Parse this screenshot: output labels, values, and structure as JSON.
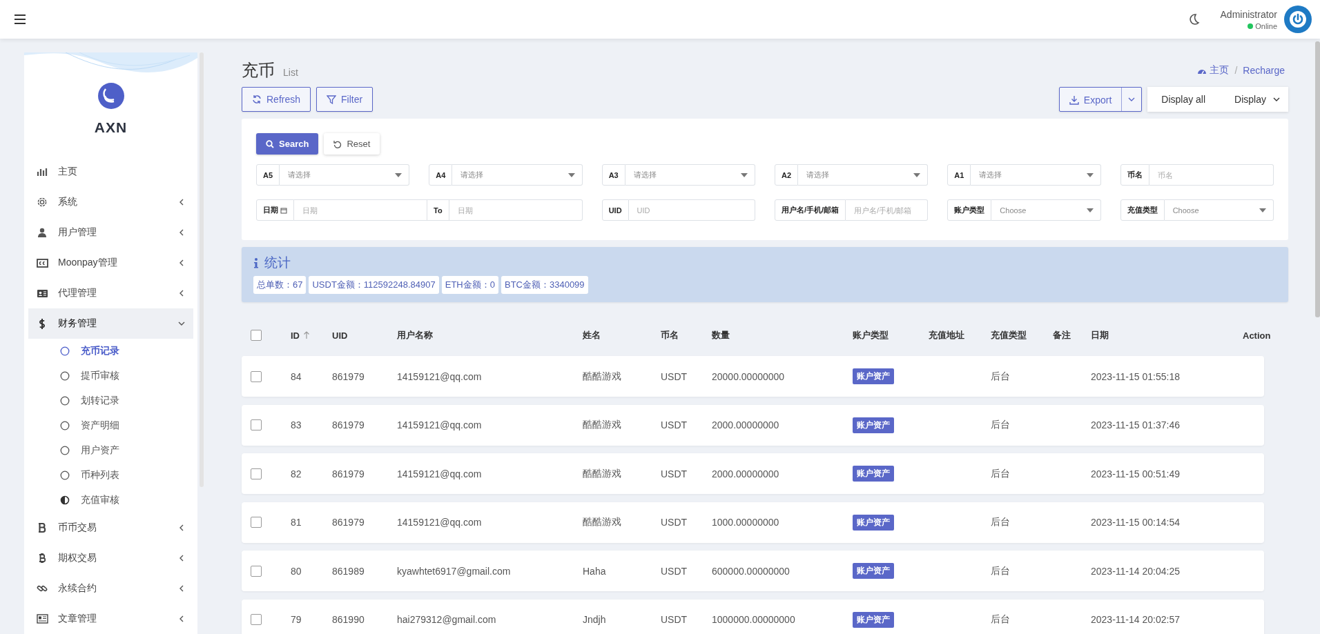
{
  "topbar": {
    "user_name": "Administrator",
    "status": "Online"
  },
  "sidebar": {
    "brand": "AXN",
    "items": [
      {
        "label": "主页",
        "kind": "link",
        "selected": false
      },
      {
        "label": "系统",
        "kind": "group",
        "expanded": false,
        "selected": false
      },
      {
        "label": "用户管理",
        "kind": "group",
        "expanded": false,
        "selected": false
      },
      {
        "label": "Moonpay管理",
        "kind": "group",
        "expanded": false,
        "selected": false
      },
      {
        "label": "代理管理",
        "kind": "group",
        "expanded": false,
        "selected": false
      },
      {
        "label": "财务管理",
        "kind": "group",
        "expanded": true,
        "selected": true,
        "children": [
          {
            "label": "充币记录",
            "kind": "outline",
            "selected": true
          },
          {
            "label": "提币审核",
            "kind": "outline",
            "selected": false
          },
          {
            "label": "划转记录",
            "kind": "outline",
            "selected": false
          },
          {
            "label": "资产明细",
            "kind": "outline",
            "selected": false
          },
          {
            "label": "用户资产",
            "kind": "outline",
            "selected": false
          },
          {
            "label": "币种列表",
            "kind": "outline",
            "selected": false
          },
          {
            "label": "充值审核",
            "kind": "half",
            "selected": false
          }
        ]
      },
      {
        "label": "币币交易",
        "kind": "group",
        "expanded": false,
        "selected": false
      },
      {
        "label": "期权交易",
        "kind": "group",
        "expanded": false,
        "selected": false
      },
      {
        "label": "永续合约",
        "kind": "group",
        "expanded": false,
        "selected": false
      },
      {
        "label": "文章管理",
        "kind": "group",
        "expanded": false,
        "selected": false
      }
    ]
  },
  "page": {
    "title": "充币",
    "subtitle": "List",
    "breadcrumb": [
      "主页",
      "Recharge"
    ],
    "breadcrumb_separator": "/"
  },
  "toolbar": {
    "left_buttons": [
      "Refresh",
      "Filter"
    ],
    "export": "Export",
    "display_all": "Display all",
    "display": "Display"
  },
  "filters": {
    "search": "Search",
    "reset": "Reset",
    "fields": [
      {
        "kind": "select",
        "label": "A5",
        "placeholder": "请选择"
      },
      {
        "kind": "select",
        "label": "A4",
        "placeholder": "请选择"
      },
      {
        "kind": "select",
        "label": "A3",
        "placeholder": "请选择"
      },
      {
        "kind": "select",
        "label": "A2",
        "placeholder": "请选择"
      },
      {
        "kind": "select",
        "label": "A1",
        "placeholder": "请选择"
      },
      {
        "kind": "input",
        "label": "币名",
        "placeholder": "币名"
      },
      {
        "kind": "daterange",
        "label": "日期",
        "placeholder": "日期",
        "to_label": "To",
        "to_placeholder": "日期"
      },
      {
        "kind": "input",
        "label": "UID",
        "placeholder": "UID"
      },
      {
        "kind": "input",
        "label": "用户名/手机/邮箱",
        "placeholder": "用户名/手机/邮箱"
      },
      {
        "kind": "select",
        "label": "账户类型",
        "placeholder": "Choose"
      },
      {
        "kind": "select",
        "label": "充值类型",
        "placeholder": "Choose"
      }
    ]
  },
  "stats": {
    "title": "统计",
    "items": [
      "总单数：67",
      "USDT金额：112592248.84907",
      "ETH金额：0",
      "BTC金额：3340099"
    ]
  },
  "table": {
    "all_checked": false,
    "columns": [
      {
        "label": "ID",
        "sorted": true
      },
      {
        "label": "UID",
        "sorted": false
      },
      {
        "label": "用户名称",
        "sorted": false
      },
      {
        "label": "姓名",
        "sorted": false
      },
      {
        "label": "币名",
        "sorted": false
      },
      {
        "label": "数量",
        "sorted": false
      },
      {
        "label": "账户类型",
        "sorted": false
      },
      {
        "label": "充值地址",
        "sorted": false
      },
      {
        "label": "充值类型",
        "sorted": false
      },
      {
        "label": "备注",
        "sorted": false
      },
      {
        "label": "日期",
        "sorted": false
      },
      {
        "label": "Action",
        "sorted": false
      }
    ],
    "rows": [
      {
        "checked": false,
        "id": "84",
        "uid": "861979",
        "username": "14159121@qq.com",
        "name": "酷酷游戏",
        "coin": "USDT",
        "amount": "20000.00000000",
        "account_type": "账户资产",
        "recharge_type": "后台",
        "date": "2023-11-15 01:55:18"
      },
      {
        "checked": false,
        "id": "83",
        "uid": "861979",
        "username": "14159121@qq.com",
        "name": "酷酷游戏",
        "coin": "USDT",
        "amount": "2000.00000000",
        "account_type": "账户资产",
        "recharge_type": "后台",
        "date": "2023-11-15 01:37:46"
      },
      {
        "checked": false,
        "id": "82",
        "uid": "861979",
        "username": "14159121@qq.com",
        "name": "酷酷游戏",
        "coin": "USDT",
        "amount": "2000.00000000",
        "account_type": "账户资产",
        "recharge_type": "后台",
        "date": "2023-11-15 00:51:49"
      },
      {
        "checked": false,
        "id": "81",
        "uid": "861979",
        "username": "14159121@qq.com",
        "name": "酷酷游戏",
        "coin": "USDT",
        "amount": "1000.00000000",
        "account_type": "账户资产",
        "recharge_type": "后台",
        "date": "2023-11-15 00:14:54"
      },
      {
        "checked": false,
        "id": "80",
        "uid": "861989",
        "username": "kyawhtet6917@gmail.com",
        "name": "Haha",
        "coin": "USDT",
        "amount": "600000.00000000",
        "account_type": "账户资产",
        "recharge_type": "后台",
        "date": "2023-11-14 20:04:25"
      },
      {
        "checked": false,
        "id": "79",
        "uid": "861990",
        "username": "hai279312@gmail.com",
        "name": "Jndjh",
        "coin": "USDT",
        "amount": "1000000.00000000",
        "account_type": "账户资产",
        "recharge_type": "后台",
        "date": "2023-11-14 20:02:57"
      }
    ]
  }
}
